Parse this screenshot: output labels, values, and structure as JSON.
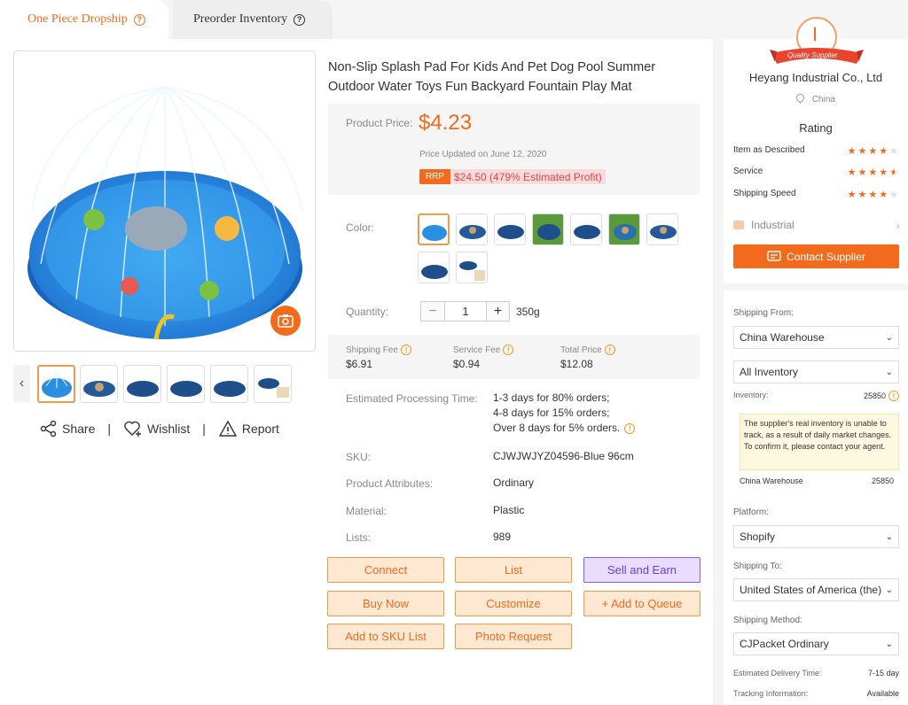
{
  "tabs": [
    {
      "label": "One Piece Dropship"
    },
    {
      "label": "Preorder Inventory"
    }
  ],
  "product": {
    "title": "Non-Slip Splash Pad For Kids And Pet Dog Pool Summer Outdoor Water Toys Fun Backyard Fountain Play Mat",
    "price_label": "Product Price:",
    "price": "$4.23",
    "updated": "Price Updated on June 12, 2020",
    "rrp_tag": "RRP",
    "rrp_value": "$24.50 (479% Estimated Profit)",
    "color_label": "Color:",
    "quantity_label": "Quantity:",
    "quantity": "1",
    "weight": "350g",
    "fees": {
      "shipping_label": "Shipping Fee",
      "shipping": "$6.91",
      "service_label": "Service Fee",
      "service": "$0.94",
      "total_label": "Total Price",
      "total": "$12.08"
    },
    "processing_label": "Estimated Processing Time:",
    "processing": [
      "1-3 days for 80% orders;",
      "4-8 days for 15% orders;",
      "Over 8 days for 5% orders."
    ],
    "sku_label": "SKU:",
    "sku": "CJWJWJYZ04596-Blue 96cm",
    "attr_label": "Product Attributes:",
    "attr": "Ordinary",
    "material_label": "Material:",
    "material": "Plastic",
    "lists_label": "Lists:",
    "lists": "989"
  },
  "share": {
    "share": "Share",
    "sep": "|",
    "wishlist": "Wishlist",
    "report": "Report"
  },
  "buttons": {
    "connect": "Connect",
    "list": "List",
    "sell": "Sell and Earn",
    "buy": "Buy Now",
    "customize": "Customize",
    "queue": "+ Add to Queue",
    "sku_list": "Add to SKU List",
    "photo": "Photo Request"
  },
  "supplier": {
    "ribbon": "Quality Supplier",
    "badge_letter": "I",
    "name": "Heyang Industrial Co., Ltd",
    "location": "China",
    "rating_title": "Rating",
    "ratings": [
      {
        "label": "Item as Described",
        "stars": 4
      },
      {
        "label": "Service",
        "stars": 4.5
      },
      {
        "label": "Shipping Speed",
        "stars": 4
      }
    ],
    "industry": "Industrial",
    "contact": "Contact Supplier"
  },
  "shipping": {
    "from_label": "Shipping From:",
    "from": "China Warehouse",
    "inventory_select": "All Inventory",
    "inventory_label": "Inventory:",
    "inventory": "25850",
    "note": "The supplier's real inventory is unable to track, as a result of daily market changes. To confirm it, please contact your agent.",
    "warehouse": "China Warehouse",
    "warehouse_count": "25850",
    "platform_label": "Platform:",
    "platform": "Shopify",
    "to_label": "Shipping To:",
    "to": "United States of America (the)",
    "method_label": "Shipping Method:",
    "method": "CJPacket Ordinary",
    "delivery_label": "Estimated Delivery Time:",
    "delivery": "7-15 day",
    "tracking_label": "Tracking Information:",
    "tracking": "Available"
  },
  "colors": {
    "accent": "#f26b1d",
    "purple": "#6d3fd6",
    "pool_blue": "#2a8fe0"
  }
}
